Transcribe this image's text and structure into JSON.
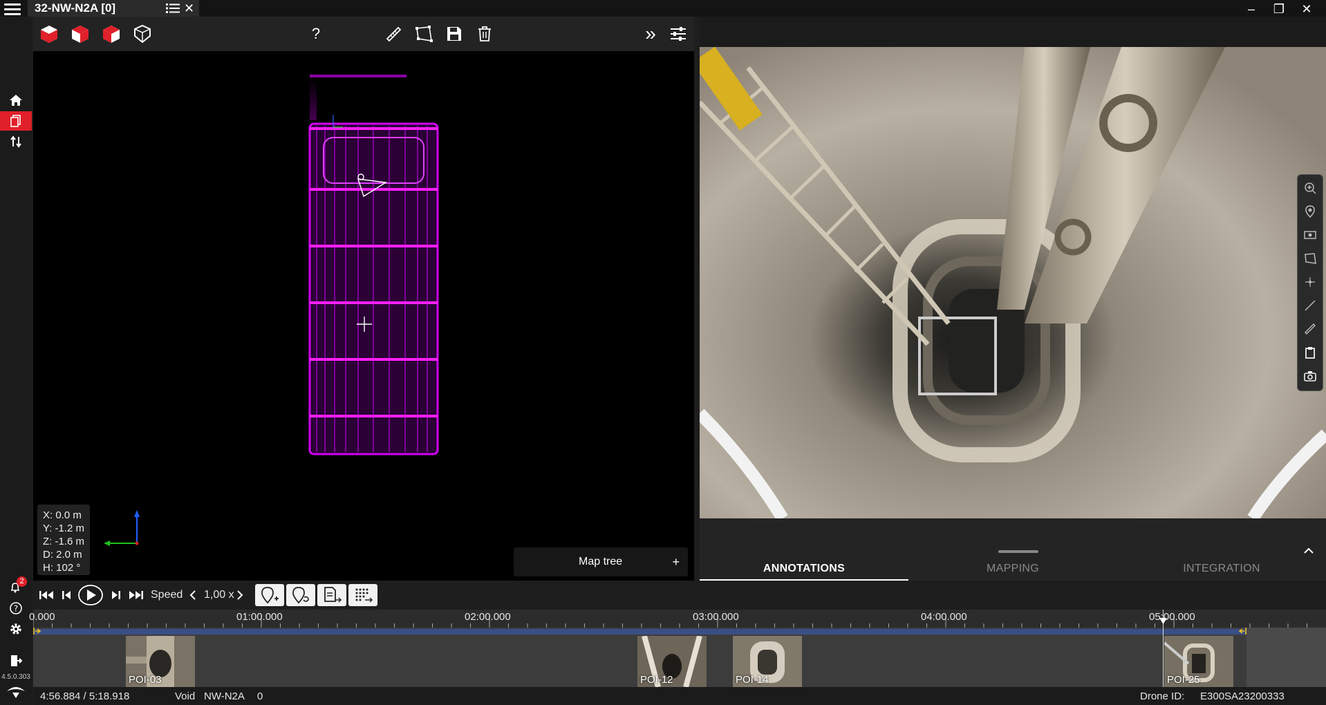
{
  "window": {
    "tab_title": "32-NW-N2A [0]",
    "close_glyph": "✕",
    "minimize_glyph": "–",
    "restore_glyph": "❐",
    "window_close_glyph": "✕"
  },
  "sidebar": {
    "items": [
      {
        "icon": "home-icon"
      },
      {
        "icon": "documents-icon",
        "active": true
      },
      {
        "icon": "transfer-icon"
      }
    ],
    "notifications_count": "2",
    "version": "4.5.0.303"
  },
  "viewer_toolbar": {
    "help_label": "?",
    "expand_label": "»"
  },
  "coords": {
    "x": "X:  0.0 m",
    "y": "Y:  -1.2 m",
    "z": "Z:  -1.6 m",
    "d": "D:  2.0 m",
    "h": "H:   102 °"
  },
  "map_tree": {
    "label": "Map tree",
    "plus": "+"
  },
  "panel_tabs": [
    {
      "label": "ANNOTATIONS",
      "active": true
    },
    {
      "label": "MAPPING",
      "active": false
    },
    {
      "label": "INTEGRATION",
      "active": false
    }
  ],
  "playback": {
    "speed_label": "Speed",
    "speed_value": "1,00 x",
    "progress_fraction": 0.951
  },
  "timeline": {
    "labels": [
      "0.000",
      "01:00.000",
      "02:00.000",
      "03:00.000",
      "04:00.000",
      "05:00.000"
    ],
    "pois": [
      "POI-03",
      "POI-12",
      "POI-14",
      "POI-25"
    ]
  },
  "status": {
    "time": "4:56.884 / 5:18.918",
    "void_label": "Void",
    "void_name": "NW-N2A",
    "void_index": "0",
    "drone_label": "Drone ID:",
    "drone_id": "E300SA23200333"
  },
  "colors": {
    "accent": "#e0202a",
    "point_cloud": "#c000e0",
    "timeline_bar": "#3a4f85"
  }
}
